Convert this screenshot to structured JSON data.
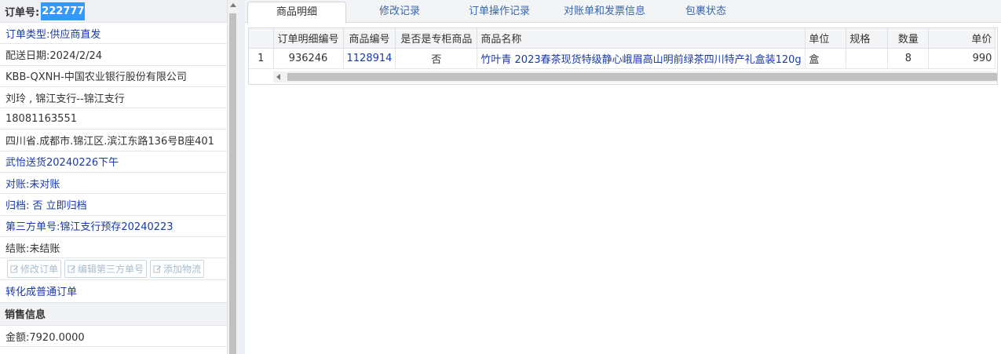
{
  "order": {
    "label": "订单号:",
    "number": "222777"
  },
  "info_rows": [
    {
      "text": "订单类型:供应商直发",
      "color": "blue"
    },
    {
      "text": "配送日期:2024/2/24",
      "color": "dark"
    },
    {
      "text": "KBB-QXNH-中国农业银行股份有限公司",
      "color": "dark"
    },
    {
      "text": "刘玲 , 锦江支行--锦江支行",
      "color": "dark"
    },
    {
      "text": "18081163551",
      "color": "dark"
    },
    {
      "text": "四川省.成都市.锦江区.滨江东路136号B座401",
      "color": "dark"
    },
    {
      "text": "武怡送货20240226下午",
      "color": "blue"
    },
    {
      "text": "对账:未对账",
      "color": "blue"
    },
    {
      "text": "归档: 否 立即归档",
      "color": "blue"
    },
    {
      "text": "第三方单号:锦江支行预存20240223",
      "color": "blue"
    },
    {
      "text": "结账:未结账",
      "color": "dark"
    }
  ],
  "action_buttons": [
    {
      "label": "修改订单",
      "icon": "edit-icon"
    },
    {
      "label": "编辑第三方单号",
      "icon": "edit-icon"
    },
    {
      "label": "添加物流",
      "icon": "edit-icon"
    }
  ],
  "convert_link": "转化成普通订单",
  "sales_section": {
    "title": "销售信息",
    "amount": "金额:7920.0000"
  },
  "tabs": [
    {
      "label": "商品明细",
      "active": true
    },
    {
      "label": "修改记录",
      "active": false
    },
    {
      "label": "订单操作记录",
      "active": false
    },
    {
      "label": "对账单和发票信息",
      "active": false
    },
    {
      "label": "包裹状态",
      "active": false
    }
  ],
  "table": {
    "columns": [
      "",
      "订单明细编号",
      "商品编号",
      "是否是专柜商品",
      "商品名称",
      "单位",
      "规格",
      "数量",
      "单价"
    ],
    "rows": [
      [
        "1",
        "936246",
        "1128914",
        "否",
        "竹叶青 2023春茶现货特级静心峨眉高山明前绿茶四川特产礼盒装120g",
        "盒",
        "",
        "8",
        "990"
      ]
    ]
  },
  "colors": {
    "accent": "#3399ff",
    "link": "#1a3aa8",
    "tab_text": "#3a66a8"
  }
}
